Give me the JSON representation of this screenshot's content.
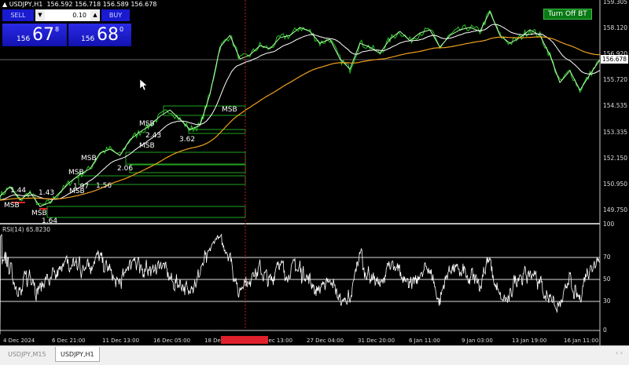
{
  "header": {
    "symbol": "USDJPY,H1",
    "ohlc": "156.592 156.718 156.589 156.678"
  },
  "trade_panel": {
    "sell_label": "SELL",
    "buy_label": "BUY",
    "lot": "0.10",
    "sell_big": "156",
    "sell_main": "67",
    "sell_pip": "8",
    "buy_big": "156",
    "buy_main": "68",
    "buy_pip": "0"
  },
  "button_bt": "Turn Off BT",
  "price_axis": [
    "159.305",
    "158.120",
    "156.920",
    "155.720",
    "154.535",
    "153.335",
    "152.150",
    "150.950",
    "149.750"
  ],
  "current_price": "156.678",
  "rsi": {
    "title": "RSI(14) 65.8230",
    "levels": [
      "100",
      "70",
      "50",
      "30",
      "0"
    ],
    "period": 14,
    "value": 65.823
  },
  "time_axis": [
    "4 Dec 2024",
    "6 Dec 21:00",
    "11 Dec 13:00",
    "16 Dec 05:00",
    "18 Dec 21:00",
    "23 Dec 13:00",
    "27 Dec 04:00",
    "31 Dec 20:00",
    "6 Jan 11:00",
    "9 Jan 03:00",
    "13 Jan 19:00",
    "16 Jan 11:00"
  ],
  "annotations": [
    "MSB",
    "1.44",
    "1.43",
    "MSB",
    "1.64",
    "MSB",
    "1.97",
    "1.56",
    "MSB",
    "MSB",
    "2.06",
    "MSB",
    "2.43",
    "MSB",
    "3.62",
    "MSB"
  ],
  "tabs": [
    "USDJPY,M15",
    "USDJPY,H1"
  ],
  "colors": {
    "price": "#22c81e",
    "fast_ma": "#ffffff",
    "slow_ma": "#f0a020",
    "zones": "#1fa51f",
    "accent": "#1a1ad0",
    "cursor": "#e02020"
  },
  "chart_data": {
    "type": "line",
    "symbol": "USDJPY",
    "timeframe": "H1",
    "ylim": [
      149.0,
      159.4
    ],
    "close": [
      150.53,
      150.96,
      150.36,
      150.71,
      150.07,
      150.25,
      150.71,
      151.17,
      151.52,
      151.77,
      152.48,
      152.66,
      152.37,
      153.08,
      153.43,
      153.72,
      154.14,
      154.42,
      154.0,
      153.54,
      153.72,
      155.13,
      157.25,
      157.78,
      156.72,
      156.9,
      157.32,
      157.18,
      157.68,
      157.78,
      158.14,
      157.96,
      157.43,
      157.61,
      156.72,
      156.26,
      157.43,
      157.25,
      156.97,
      157.61,
      157.96,
      157.54,
      157.89,
      158.03,
      157.25,
      157.78,
      158.03,
      158.14,
      157.96,
      158.85,
      157.78,
      157.43,
      157.68,
      158.03,
      157.78,
      156.9,
      155.66,
      156.19,
      155.31,
      156.02,
      156.68
    ]
  }
}
